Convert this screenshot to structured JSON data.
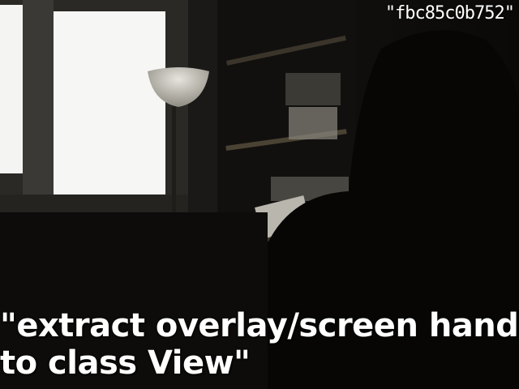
{
  "overlay": {
    "commit_hash": "\"fbc85c0b752\"",
    "message_line1": "\"extract overlay/screen handling",
    "message_line2": "to class View\""
  }
}
